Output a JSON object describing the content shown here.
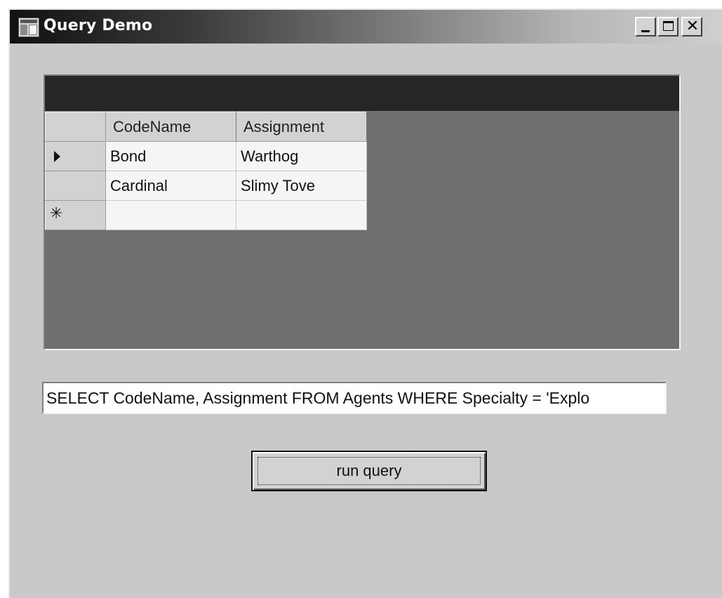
{
  "window": {
    "title": "Query Demo",
    "controls": {
      "minimize": "minimize",
      "maximize": "maximize",
      "close": "close"
    }
  },
  "grid": {
    "columns": [
      "CodeName",
      "Assignment"
    ],
    "rows": [
      {
        "indicator": "current-row-arrow",
        "cells": [
          "Bond",
          "Warthog"
        ]
      },
      {
        "indicator": "",
        "cells": [
          "Cardinal",
          "Slimy Tove"
        ]
      },
      {
        "indicator": "new-row-asterisk",
        "cells": [
          "",
          ""
        ]
      }
    ],
    "new_row_glyph": "✳"
  },
  "query": {
    "value": "SELECT CodeName, Assignment FROM Agents WHERE Specialty = 'Explo"
  },
  "button": {
    "label": "run query"
  },
  "icons": {
    "app": "app-window-icon",
    "close_glyph": "✕"
  },
  "colors": {
    "window_bg": "#c9c9c9",
    "grid_bg": "#6f6f6f",
    "grid_caption": "#262626"
  }
}
